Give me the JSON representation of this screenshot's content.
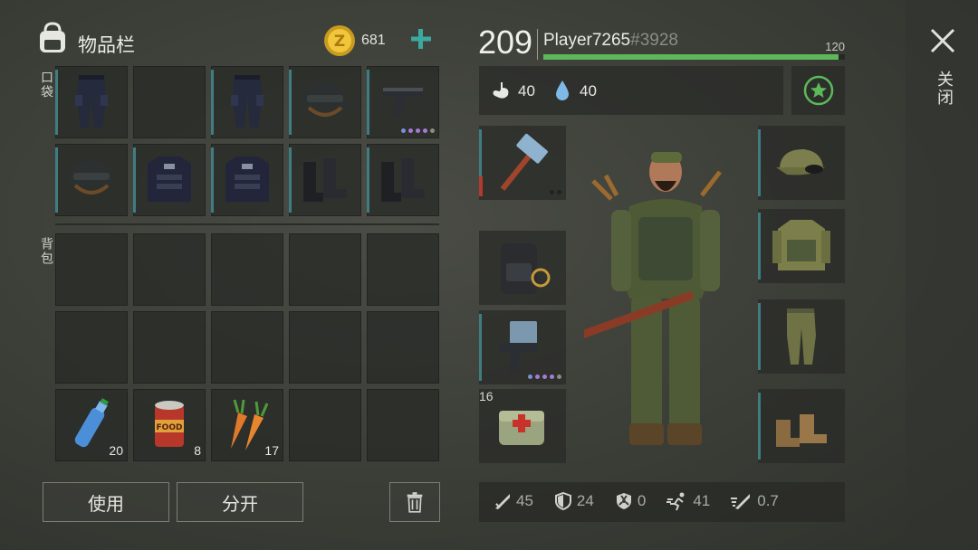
{
  "inventory": {
    "title": "物品栏",
    "coins": "681",
    "pockets_label": "口袋",
    "backpack_label": "背包",
    "use_label": "使用",
    "split_label": "分开",
    "counts": {
      "water": "20",
      "food": "8",
      "carrot": "17"
    }
  },
  "player": {
    "level": "209",
    "name": "Player7265",
    "id": "#3928",
    "xp_max": "120",
    "xp_progress": 0.98,
    "hunger": "40",
    "thirst": "40",
    "medkit_count": "16"
  },
  "close_label": "关闭",
  "stats": {
    "attack": "45",
    "armor": "24",
    "radiation": "0",
    "speed": "41",
    "attack_speed": "0.7"
  },
  "colors": {
    "accent": "#3f7d82",
    "xp_bar": "#5db85a",
    "plus": "#3aa9a0"
  }
}
